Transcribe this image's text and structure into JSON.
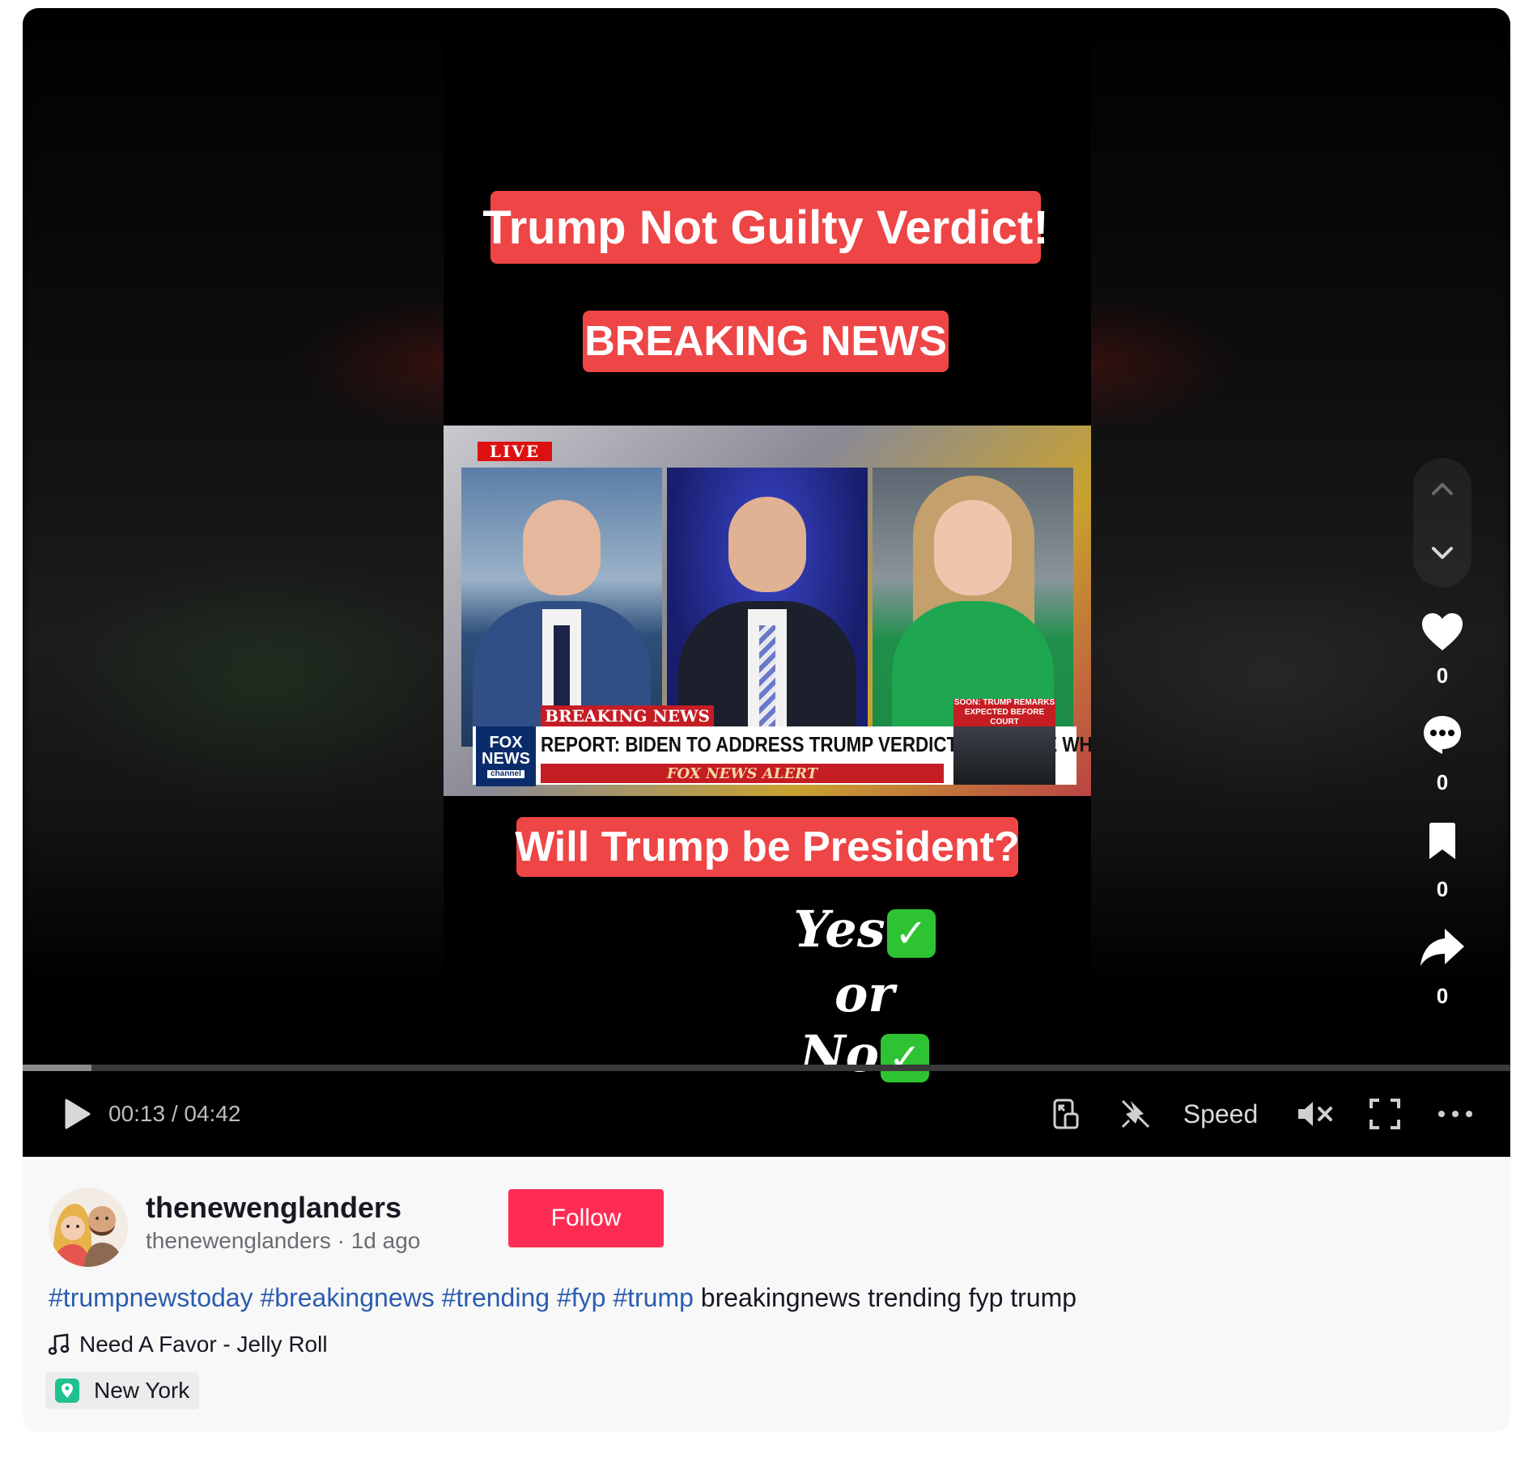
{
  "video": {
    "overlay": {
      "title": "Trump Not Guilty Verdict!",
      "breaking": "BREAKING NEWS",
      "question": "Will Trump be President?",
      "poll_yes": "Yes",
      "poll_or": "or",
      "poll_no": "No",
      "check_glyph": "✓"
    },
    "broadcast": {
      "live": "LIVE",
      "breaking_news": "BREAKING NEWS",
      "network_top": "FOX",
      "network_mid": "NEWS",
      "network_sub": "channel",
      "headline": "REPORT: BIDEN TO ADDRESS TRUMP VERDICT FROM THE WH",
      "alert": "FOX NEWS ALERT",
      "side_note": "SOON: TRUMP REMARKS EXPECTED BEFORE COURT"
    },
    "rail": {
      "likes": "0",
      "comments": "0",
      "saves": "0",
      "shares": "0"
    },
    "controls": {
      "time": "00:13 / 04:42",
      "progress": 0.046,
      "speed_label": "Speed"
    }
  },
  "author": {
    "display_name": "thenewenglanders",
    "meta": "thenewenglanders · 1d ago",
    "follow_label": "Follow"
  },
  "caption": {
    "hashtags": [
      "#trumpnewstoday",
      "#breakingnews",
      "#trending",
      "#fyp",
      "#trump"
    ],
    "text": "breakingnews trending fyp trump"
  },
  "music": "Need A Favor - Jelly Roll",
  "location": "New York",
  "colors": {
    "accent_red": "#fe2c55",
    "overlay_red": "#ee4546",
    "hashtag_blue": "#2b5db0",
    "location_green": "#20c190"
  }
}
